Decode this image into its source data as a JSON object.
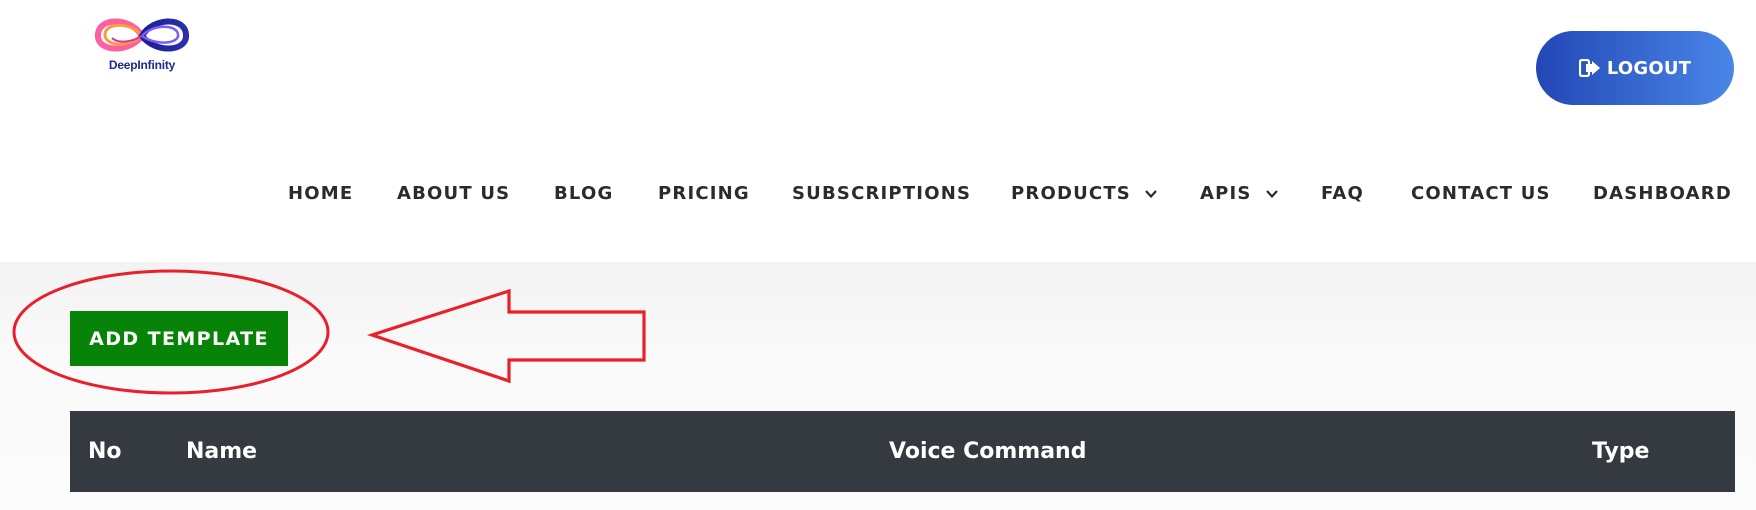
{
  "brand": {
    "logo_text": "DeepInfinity"
  },
  "header": {
    "logout_label": "LOGOUT"
  },
  "nav": {
    "items": [
      {
        "label": "HOME"
      },
      {
        "label": "ABOUT US"
      },
      {
        "label": "BLOG"
      },
      {
        "label": "PRICING"
      },
      {
        "label": "SUBSCRIPTIONS"
      },
      {
        "label": "PRODUCTS",
        "dropdown": true
      },
      {
        "label": "APIS",
        "dropdown": true
      },
      {
        "label": "FAQ"
      },
      {
        "label": "CONTACT US"
      },
      {
        "label": "DASHBOARD"
      }
    ]
  },
  "main": {
    "add_template_label": "ADD TEMPLATE",
    "table": {
      "columns": [
        "No",
        "Name",
        "Voice Command",
        "Type"
      ]
    }
  },
  "colors": {
    "logout_gradient_start": "#2247b5",
    "logout_gradient_end": "#4a86e8",
    "add_button": "#078407",
    "table_header": "#343a40",
    "annotation": "#e8202a"
  },
  "icons": {
    "logout": "sign-out-icon",
    "dropdown": "chevron-down-icon",
    "logo": "infinity-logo-icon"
  }
}
